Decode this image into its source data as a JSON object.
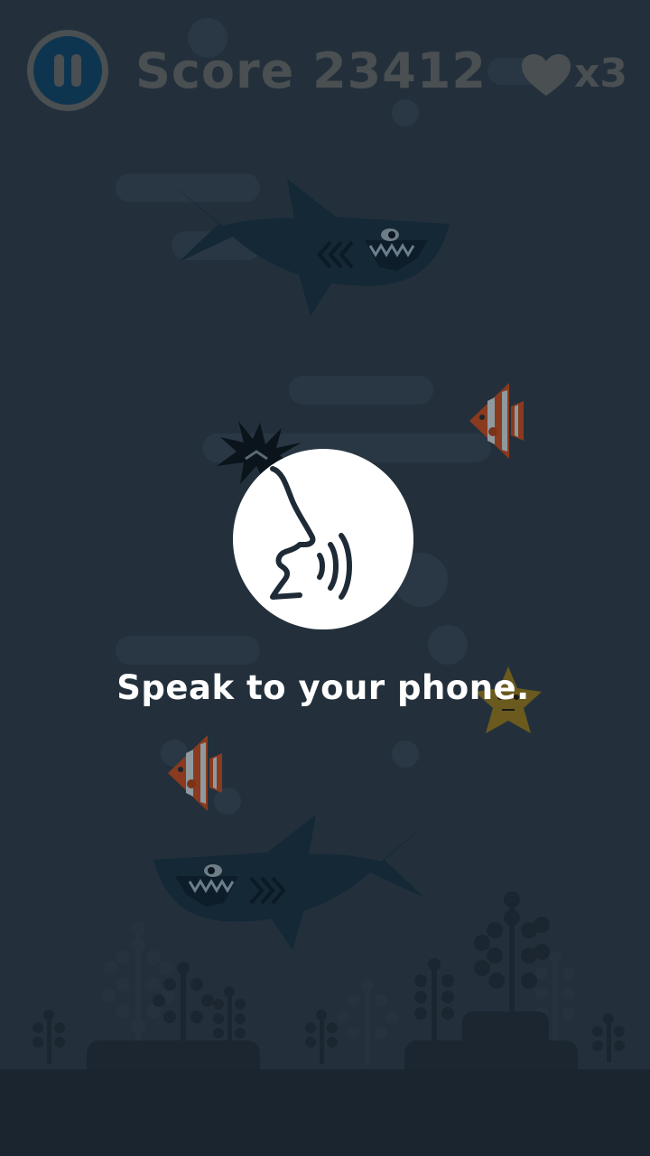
{
  "hud": {
    "score_label": "Score",
    "score_value": "23412",
    "lives_text": "x3",
    "pause_icon": "pause-icon",
    "heart_icon": "heart-icon"
  },
  "overlay": {
    "voice_icon": "speaking-head-icon",
    "prompt": "Speak to your phone."
  },
  "colors": {
    "water": "#23303c",
    "seabed": "#1a2530",
    "shark": "#142836",
    "hud_text": "#4a4f52",
    "voice_circle": "#ffffff",
    "voice_icon": "#1e2b36"
  }
}
